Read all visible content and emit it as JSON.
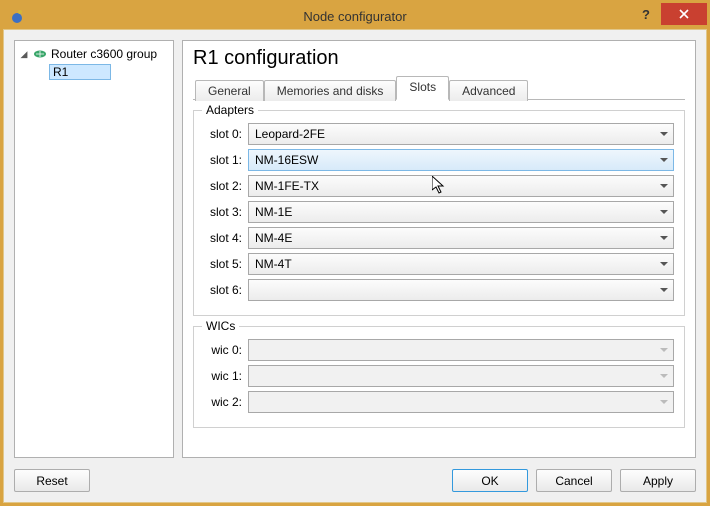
{
  "window": {
    "title": "Node configurator"
  },
  "tree": {
    "group": "Router c3600 group",
    "node": "R1"
  },
  "main": {
    "heading": "R1 configuration",
    "tabs": {
      "general": "General",
      "memories": "Memories and disks",
      "slots": "Slots",
      "advanced": "Advanced"
    }
  },
  "adapters": {
    "title": "Adapters",
    "slots": [
      {
        "label": "slot 0:",
        "value": "Leopard-2FE"
      },
      {
        "label": "slot 1:",
        "value": "NM-16ESW"
      },
      {
        "label": "slot 2:",
        "value": "NM-1FE-TX"
      },
      {
        "label": "slot 3:",
        "value": "NM-1E"
      },
      {
        "label": "slot 4:",
        "value": "NM-4E"
      },
      {
        "label": "slot 5:",
        "value": "NM-4T"
      },
      {
        "label": "slot 6:",
        "value": ""
      }
    ]
  },
  "wics": {
    "title": "WICs",
    "slots": [
      {
        "label": "wic 0:",
        "value": ""
      },
      {
        "label": "wic 1:",
        "value": ""
      },
      {
        "label": "wic 2:",
        "value": ""
      }
    ]
  },
  "buttons": {
    "reset": "Reset",
    "ok": "OK",
    "cancel": "Cancel",
    "apply": "Apply"
  }
}
